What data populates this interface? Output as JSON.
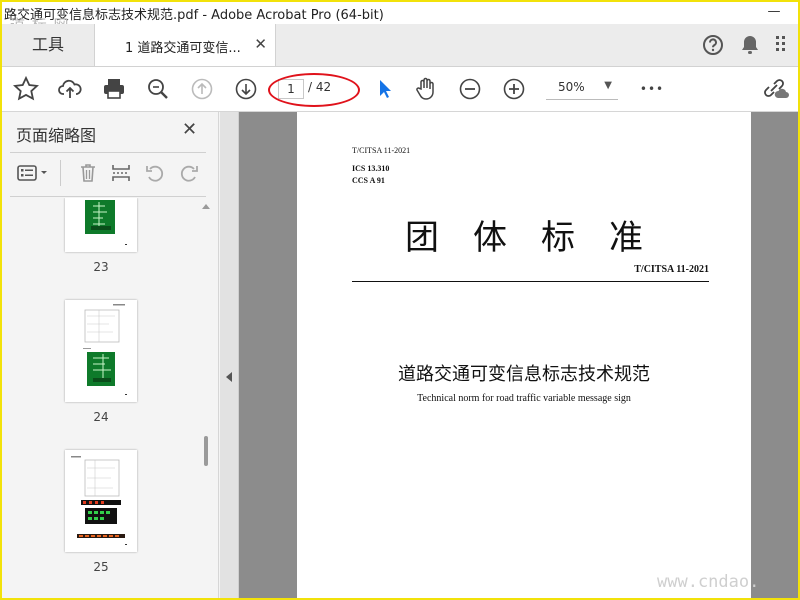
{
  "window": {
    "title": "路交通可变信息标志技术规范.pdf - Adobe Acrobat Pro (64-bit)",
    "minimize_glyph": "—"
  },
  "watermarks": {
    "top": "道 标 网",
    "bottom": "www.cndao."
  },
  "tabs": {
    "tools_label": "工具",
    "doc_label": "1 道路交通可变信...",
    "doc_close": "✕"
  },
  "toolbar": {
    "current_page": "1",
    "total_pages": "/ 42",
    "zoom": "50%",
    "more": "•••"
  },
  "panel": {
    "title": "页面缩略图",
    "close": "✕",
    "thumbnails": [
      {
        "number": "23"
      },
      {
        "number": "24"
      },
      {
        "number": "25"
      }
    ]
  },
  "document": {
    "standard_no": "T/CITSA 11-2021",
    "ics": "ICS 13.310",
    "ccs": "CCS A 91",
    "main_title": "团体标准",
    "code": "T/CITSA  11-2021",
    "cn_title": "道路交通可变信息标志技术规范",
    "en_title": "Technical norm for road traffic variable message sign"
  },
  "colors": {
    "highlight_ellipse": "#e0121b",
    "select_arrow": "#1473e6",
    "window_border": "#f2e20a"
  }
}
